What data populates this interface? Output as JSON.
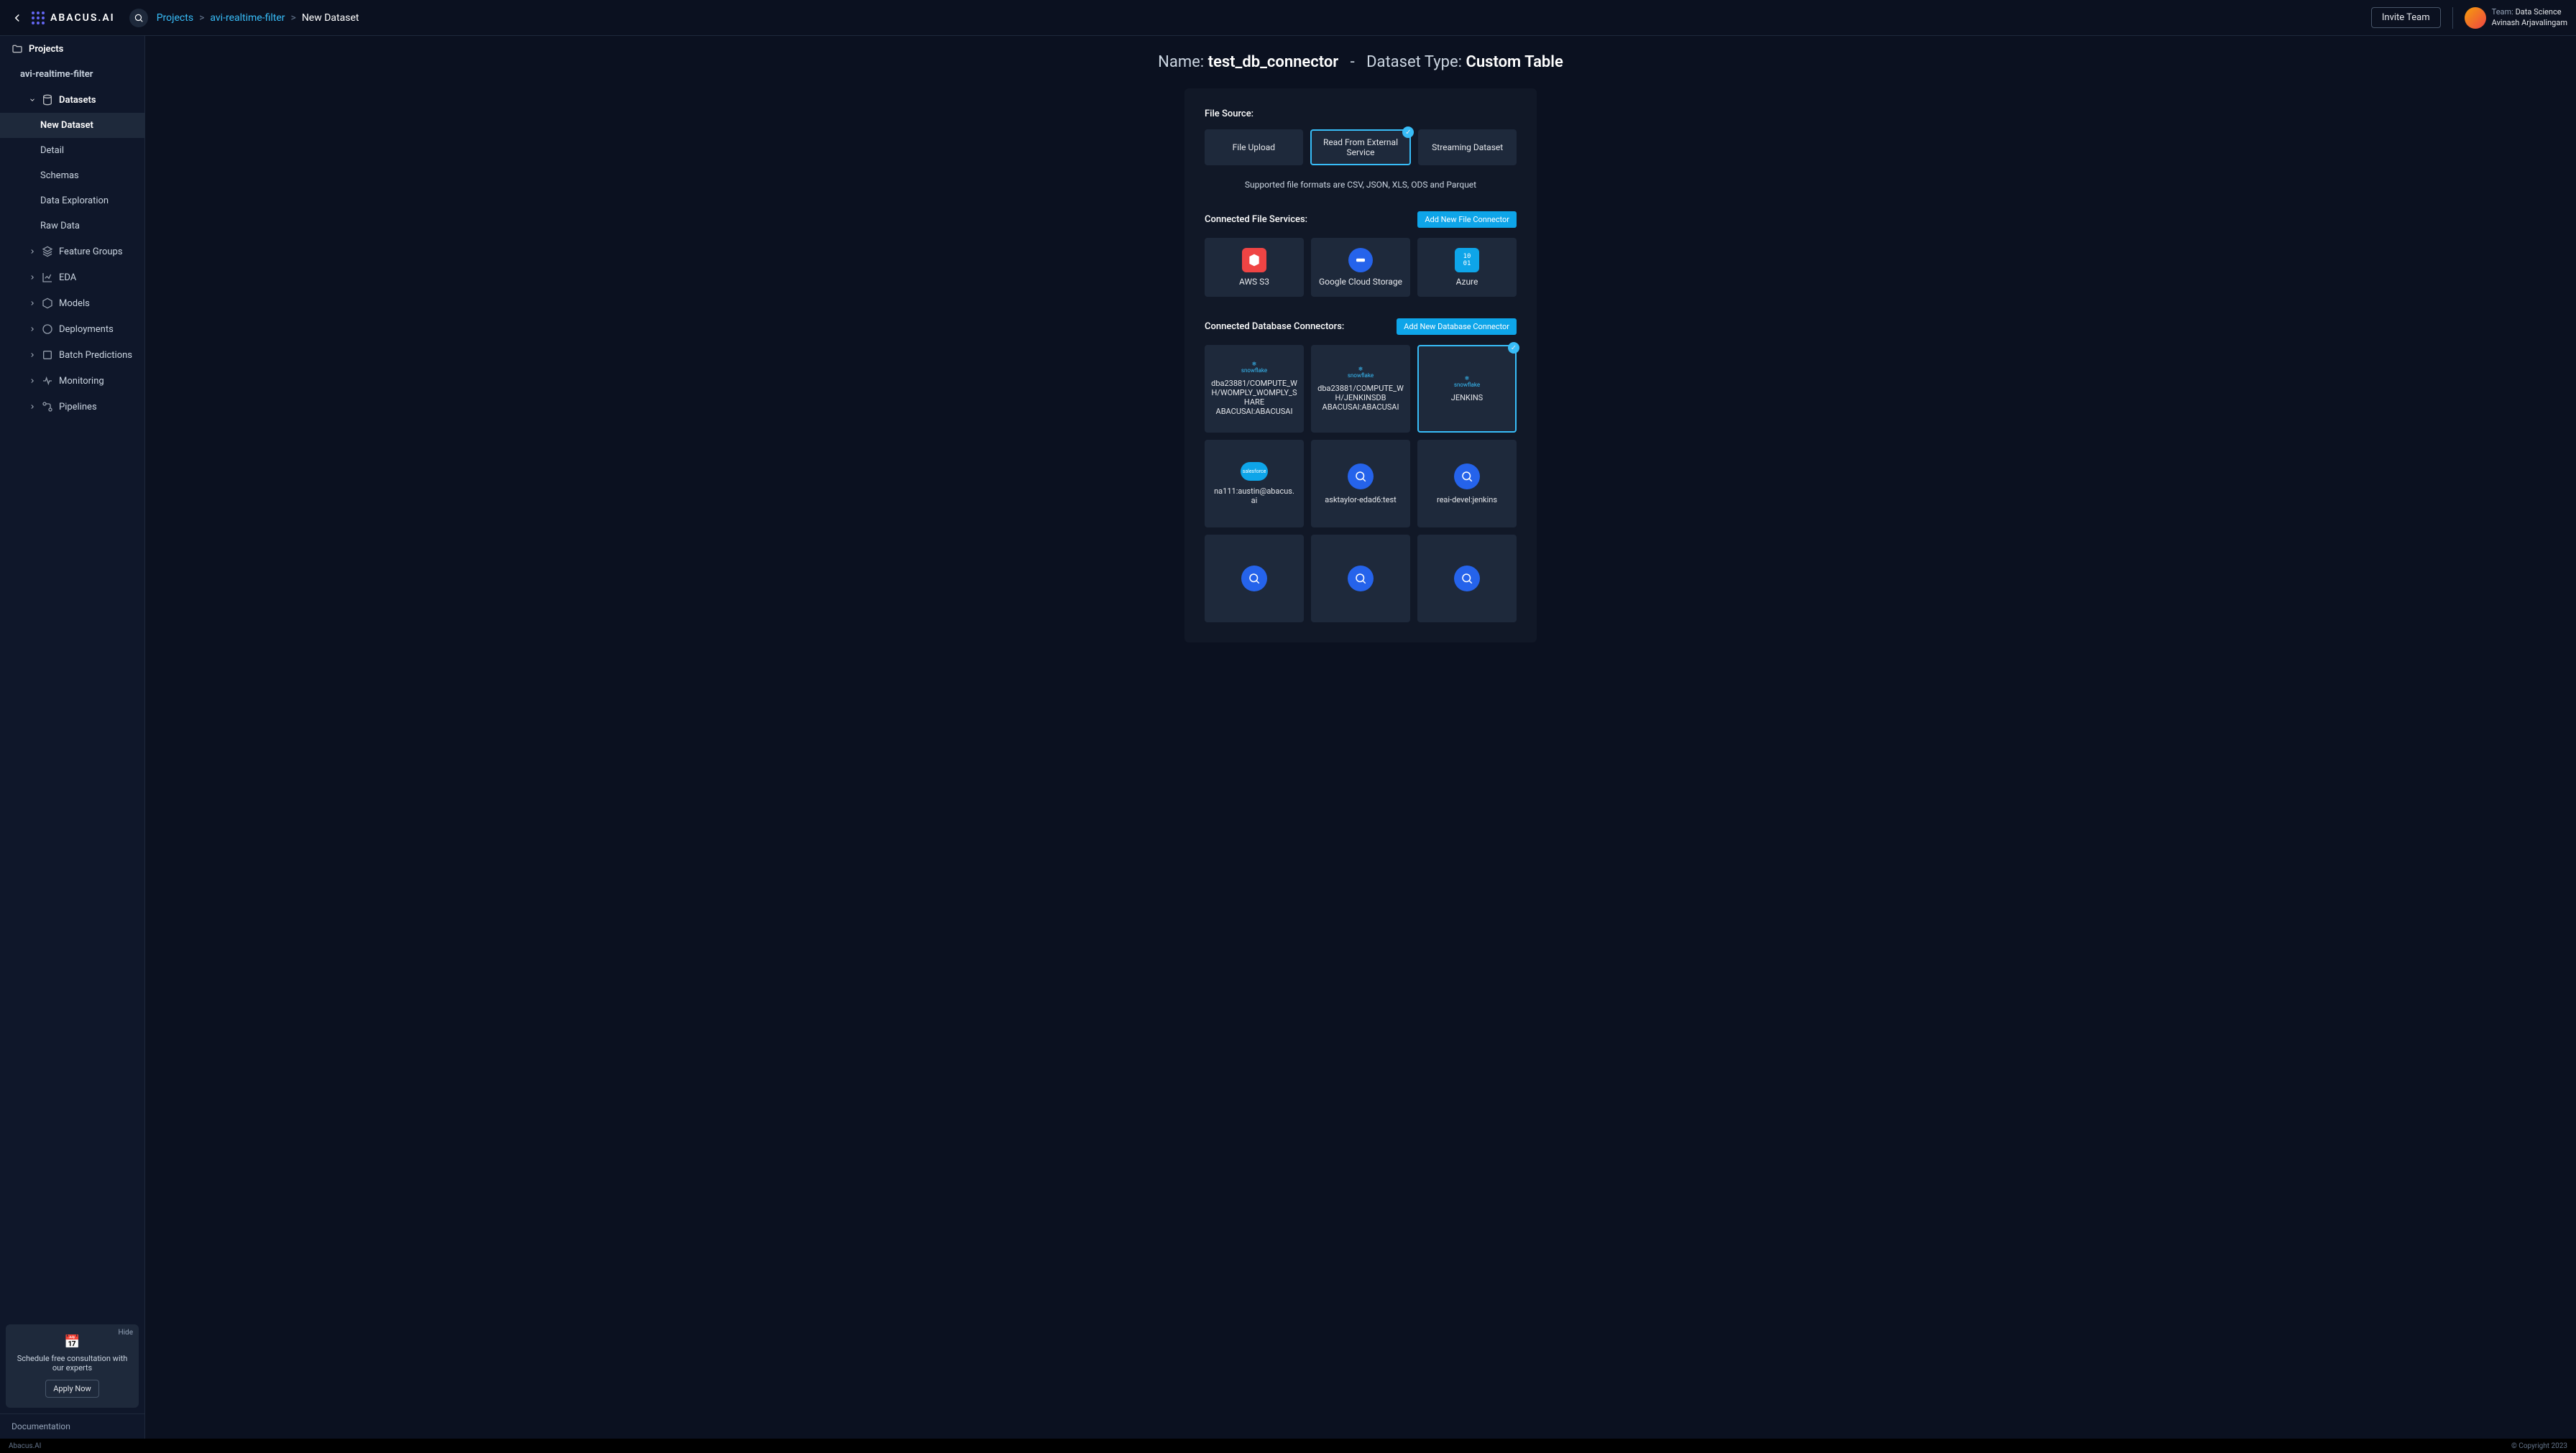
{
  "topbar": {
    "logo_text": "ABACUS.AI",
    "breadcrumb": {
      "projects": "Projects",
      "project_name": "avi-realtime-filter",
      "current": "New Dataset"
    },
    "invite": "Invite Team",
    "team_label": "Team:",
    "team_name": "Data Science",
    "user_name": "Avinash Arjavalingam"
  },
  "sidebar": {
    "projects": "Projects",
    "project": "avi-realtime-filter",
    "datasets": "Datasets",
    "new_dataset": "New Dataset",
    "detail": "Detail",
    "schemas": "Schemas",
    "data_exploration": "Data Exploration",
    "raw_data": "Raw Data",
    "feature_groups": "Feature Groups",
    "eda": "EDA",
    "models": "Models",
    "deployments": "Deployments",
    "batch_predictions": "Batch Predictions",
    "monitoring": "Monitoring",
    "pipelines": "Pipelines",
    "promo": {
      "hide": "Hide",
      "text": "Schedule free consultation with our experts",
      "button": "Apply Now"
    },
    "documentation": "Documentation"
  },
  "footer": {
    "brand": "Abacus.AI",
    "copyright": "© Copyright 2023"
  },
  "page": {
    "name_label": "Name:",
    "name_value": "test_db_connector",
    "sep": "-",
    "type_label": "Dataset Type:",
    "type_value": "Custom Table",
    "file_source_label": "File Source:",
    "sources": {
      "upload": "File Upload",
      "external": "Read From External Service",
      "streaming": "Streaming Dataset"
    },
    "supported": "Supported file formats are CSV,  JSON,  XLS,  ODS and Parquet",
    "file_services_label": "Connected File Services:",
    "add_file_btn": "Add New File Connector",
    "file_services": {
      "s3": "AWS S3",
      "gcs": "Google Cloud Storage",
      "azure": "Azure"
    },
    "db_label": "Connected Database Connectors:",
    "add_db_btn": "Add New Database Connector",
    "db": {
      "c1": "dba23881/COMPUTE_WH/WOMPLY_WOMPLY_SHARE ABACUSAI:ABACUSAI",
      "c2": "dba23881/COMPUTE_WH/JENKINSDB ABACUSAI:ABACUSAI",
      "c3": "JENKINS",
      "c4": "na111:austin@abacus. ai",
      "c5": "asktaylor-edad6:test",
      "c6": "reai-devel:jenkins"
    }
  }
}
